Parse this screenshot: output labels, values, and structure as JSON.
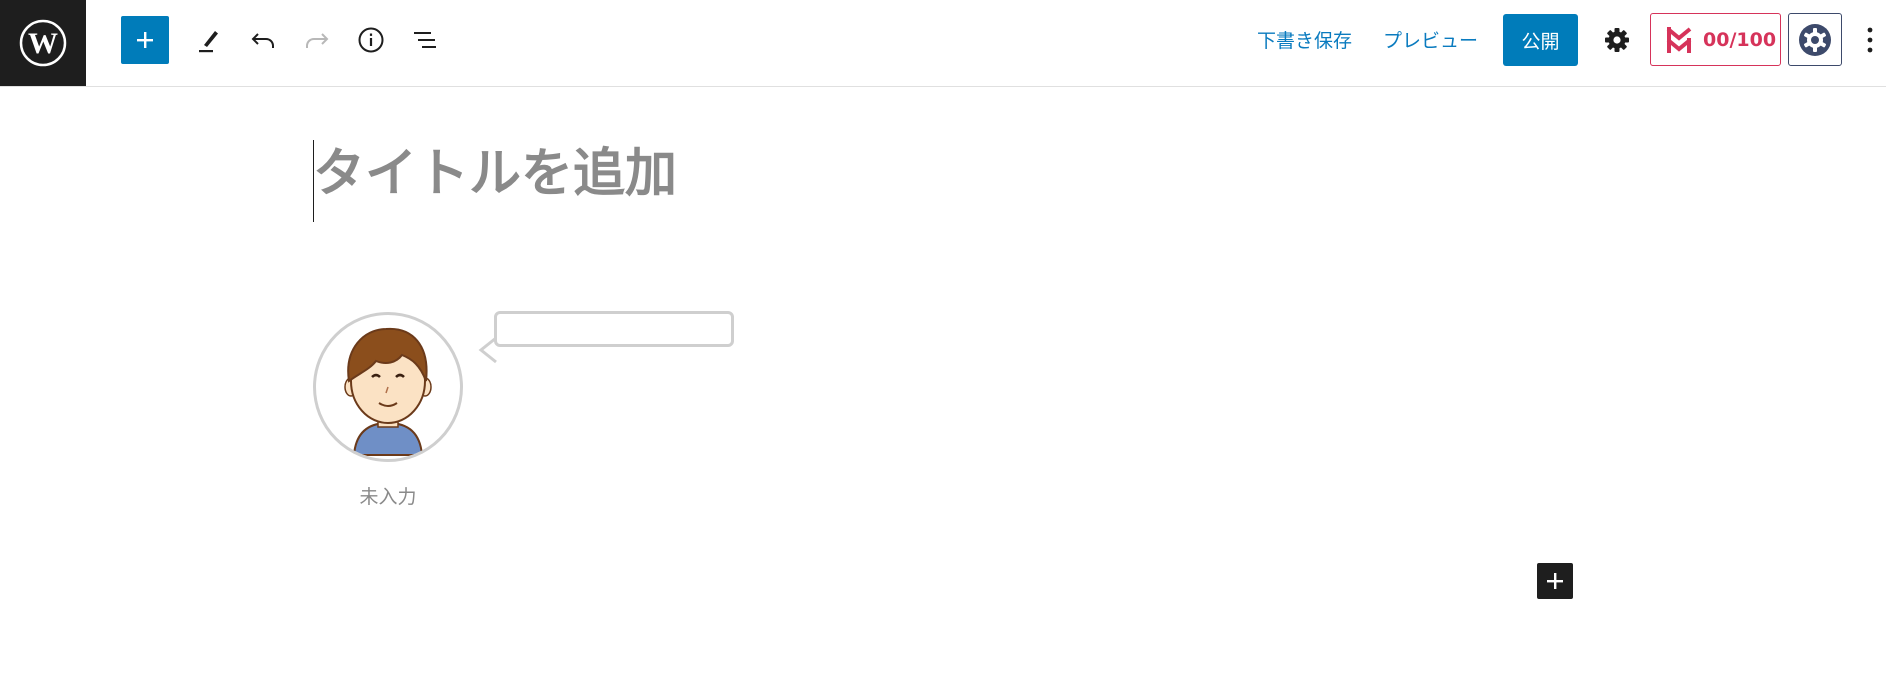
{
  "toolbar": {
    "save_draft_label": "下書き保存",
    "preview_label": "プレビュー",
    "publish_label": "公開",
    "seo_score": "00/100"
  },
  "editor": {
    "title_placeholder": "タイトルを追加",
    "speech_balloon": {
      "speaker_name": "未入力",
      "text": ""
    }
  },
  "colors": {
    "accent": "#007cba",
    "link": "#0a7bbf",
    "seo": "#d6335a",
    "dark": "#1e1e1e"
  },
  "icons": {
    "logo": "wordpress-logo-icon",
    "add": "plus-icon",
    "tools": "pencil-icon",
    "undo": "undo-icon",
    "redo": "redo-icon",
    "details": "info-icon",
    "outline": "list-view-icon",
    "settings": "gear-icon",
    "seo": "seo-logo-icon",
    "extension": "extension-gear-icon",
    "more": "more-vertical-icon",
    "block_inserter": "plus-icon"
  }
}
